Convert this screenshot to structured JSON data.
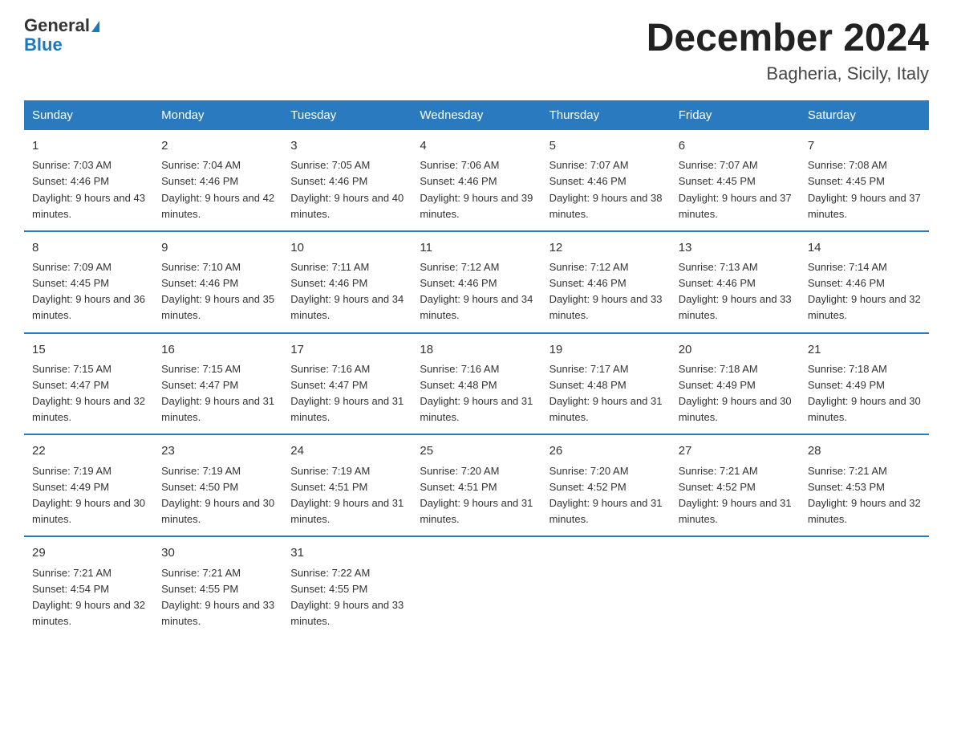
{
  "header": {
    "logo_line1": "General",
    "logo_line2": "Blue",
    "title": "December 2024",
    "subtitle": "Bagheria, Sicily, Italy"
  },
  "weekdays": [
    "Sunday",
    "Monday",
    "Tuesday",
    "Wednesday",
    "Thursday",
    "Friday",
    "Saturday"
  ],
  "weeks": [
    [
      {
        "day": 1,
        "sunrise": "7:03 AM",
        "sunset": "4:46 PM",
        "daylight": "9 hours and 43 minutes."
      },
      {
        "day": 2,
        "sunrise": "7:04 AM",
        "sunset": "4:46 PM",
        "daylight": "9 hours and 42 minutes."
      },
      {
        "day": 3,
        "sunrise": "7:05 AM",
        "sunset": "4:46 PM",
        "daylight": "9 hours and 40 minutes."
      },
      {
        "day": 4,
        "sunrise": "7:06 AM",
        "sunset": "4:46 PM",
        "daylight": "9 hours and 39 minutes."
      },
      {
        "day": 5,
        "sunrise": "7:07 AM",
        "sunset": "4:46 PM",
        "daylight": "9 hours and 38 minutes."
      },
      {
        "day": 6,
        "sunrise": "7:07 AM",
        "sunset": "4:45 PM",
        "daylight": "9 hours and 37 minutes."
      },
      {
        "day": 7,
        "sunrise": "7:08 AM",
        "sunset": "4:45 PM",
        "daylight": "9 hours and 37 minutes."
      }
    ],
    [
      {
        "day": 8,
        "sunrise": "7:09 AM",
        "sunset": "4:45 PM",
        "daylight": "9 hours and 36 minutes."
      },
      {
        "day": 9,
        "sunrise": "7:10 AM",
        "sunset": "4:46 PM",
        "daylight": "9 hours and 35 minutes."
      },
      {
        "day": 10,
        "sunrise": "7:11 AM",
        "sunset": "4:46 PM",
        "daylight": "9 hours and 34 minutes."
      },
      {
        "day": 11,
        "sunrise": "7:12 AM",
        "sunset": "4:46 PM",
        "daylight": "9 hours and 34 minutes."
      },
      {
        "day": 12,
        "sunrise": "7:12 AM",
        "sunset": "4:46 PM",
        "daylight": "9 hours and 33 minutes."
      },
      {
        "day": 13,
        "sunrise": "7:13 AM",
        "sunset": "4:46 PM",
        "daylight": "9 hours and 33 minutes."
      },
      {
        "day": 14,
        "sunrise": "7:14 AM",
        "sunset": "4:46 PM",
        "daylight": "9 hours and 32 minutes."
      }
    ],
    [
      {
        "day": 15,
        "sunrise": "7:15 AM",
        "sunset": "4:47 PM",
        "daylight": "9 hours and 32 minutes."
      },
      {
        "day": 16,
        "sunrise": "7:15 AM",
        "sunset": "4:47 PM",
        "daylight": "9 hours and 31 minutes."
      },
      {
        "day": 17,
        "sunrise": "7:16 AM",
        "sunset": "4:47 PM",
        "daylight": "9 hours and 31 minutes."
      },
      {
        "day": 18,
        "sunrise": "7:16 AM",
        "sunset": "4:48 PM",
        "daylight": "9 hours and 31 minutes."
      },
      {
        "day": 19,
        "sunrise": "7:17 AM",
        "sunset": "4:48 PM",
        "daylight": "9 hours and 31 minutes."
      },
      {
        "day": 20,
        "sunrise": "7:18 AM",
        "sunset": "4:49 PM",
        "daylight": "9 hours and 30 minutes."
      },
      {
        "day": 21,
        "sunrise": "7:18 AM",
        "sunset": "4:49 PM",
        "daylight": "9 hours and 30 minutes."
      }
    ],
    [
      {
        "day": 22,
        "sunrise": "7:19 AM",
        "sunset": "4:49 PM",
        "daylight": "9 hours and 30 minutes."
      },
      {
        "day": 23,
        "sunrise": "7:19 AM",
        "sunset": "4:50 PM",
        "daylight": "9 hours and 30 minutes."
      },
      {
        "day": 24,
        "sunrise": "7:19 AM",
        "sunset": "4:51 PM",
        "daylight": "9 hours and 31 minutes."
      },
      {
        "day": 25,
        "sunrise": "7:20 AM",
        "sunset": "4:51 PM",
        "daylight": "9 hours and 31 minutes."
      },
      {
        "day": 26,
        "sunrise": "7:20 AM",
        "sunset": "4:52 PM",
        "daylight": "9 hours and 31 minutes."
      },
      {
        "day": 27,
        "sunrise": "7:21 AM",
        "sunset": "4:52 PM",
        "daylight": "9 hours and 31 minutes."
      },
      {
        "day": 28,
        "sunrise": "7:21 AM",
        "sunset": "4:53 PM",
        "daylight": "9 hours and 32 minutes."
      }
    ],
    [
      {
        "day": 29,
        "sunrise": "7:21 AM",
        "sunset": "4:54 PM",
        "daylight": "9 hours and 32 minutes."
      },
      {
        "day": 30,
        "sunrise": "7:21 AM",
        "sunset": "4:55 PM",
        "daylight": "9 hours and 33 minutes."
      },
      {
        "day": 31,
        "sunrise": "7:22 AM",
        "sunset": "4:55 PM",
        "daylight": "9 hours and 33 minutes."
      },
      null,
      null,
      null,
      null
    ]
  ]
}
